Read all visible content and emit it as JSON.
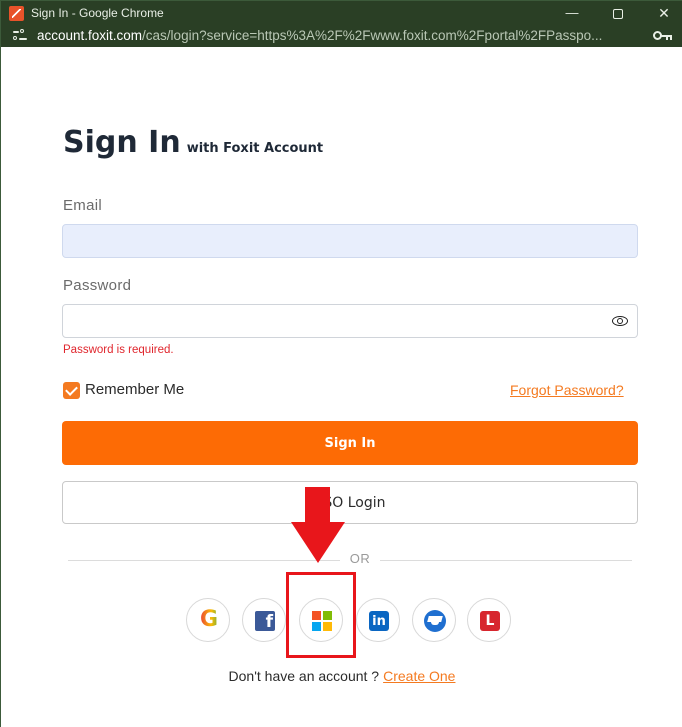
{
  "window": {
    "title": "Sign In - Google Chrome",
    "controls": {
      "minimize": "—",
      "close": "✕"
    }
  },
  "address_bar": {
    "host": "account.foxit.com",
    "path": "/cas/login?service=https%3A%2F%2Fwww.foxit.com%2Fportal%2FPasspo..."
  },
  "form": {
    "title": "Sign In",
    "subtitle": "with Foxit Account",
    "email": {
      "label": "Email",
      "value": "",
      "placeholder": ""
    },
    "password": {
      "label": "Password",
      "value": "",
      "placeholder": "",
      "error": "Password is required."
    },
    "remember_me": {
      "label": "Remember Me",
      "checked": true
    },
    "forgot_password": "Forgot Password?",
    "sign_in_button": "Sign In",
    "sso_button": "SSO Login",
    "divider": "OR"
  },
  "social_logins": [
    {
      "provider": "google",
      "glyph": "G",
      "icon": "google-icon"
    },
    {
      "provider": "facebook",
      "glyph": "f",
      "icon": "facebook-icon"
    },
    {
      "provider": "microsoft",
      "icon": "microsoft-icon",
      "colors": [
        "#f35325",
        "#81bc06",
        "#05a6f0",
        "#ffba08"
      ]
    },
    {
      "provider": "linkedin",
      "glyph": "in",
      "icon": "linkedin-icon"
    },
    {
      "provider": "education",
      "icon": "graduation-cap-icon"
    },
    {
      "provider": "l",
      "glyph": "L",
      "icon": "l-logo-icon"
    }
  ],
  "footer": {
    "text": "Don't have an account ?",
    "link": "Create One"
  },
  "colors": {
    "accent": "#fd6b05",
    "link": "#f47a20",
    "error": "#e0262d",
    "annotation": "#e8161b",
    "titlebar": "#2a3f25"
  }
}
